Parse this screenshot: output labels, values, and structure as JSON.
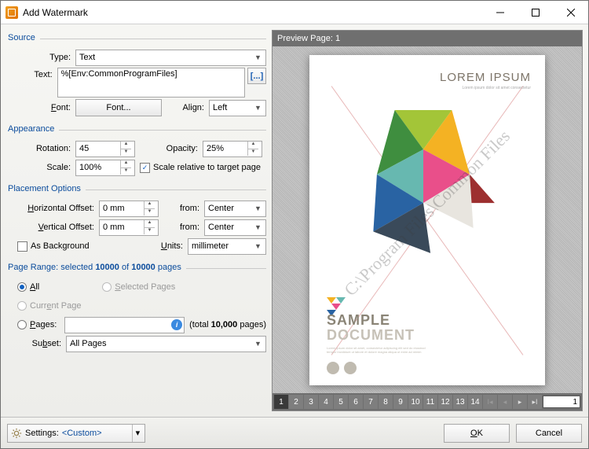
{
  "window": {
    "title": "Add Watermark"
  },
  "source": {
    "section": "Source",
    "type_label": "Type:",
    "type_value": "Text",
    "text_label": "Text:",
    "text_value": "%[Env:CommonProgramFiles]",
    "macro_button": "[...]",
    "font_label": "Font:",
    "font_button": "Font...",
    "align_label": "Align:",
    "align_value": "Left"
  },
  "appearance": {
    "section": "Appearance",
    "rotation_label": "Rotation:",
    "rotation_value": "45",
    "opacity_label": "Opacity:",
    "opacity_value": "25%",
    "scale_label": "Scale:",
    "scale_value": "100%",
    "scale_relative_label": "Scale relative to target page",
    "scale_relative_checked": true
  },
  "placement": {
    "section": "Placement Options",
    "hoffset_label": "Horizontal Offset:",
    "hoffset_value": "0 mm",
    "hoffset_from_label": "from:",
    "hoffset_from_value": "Center",
    "voffset_label": "Vertical Offset:",
    "voffset_value": "0 mm",
    "voffset_from_label": "from:",
    "voffset_from_value": "Center",
    "as_background_label": "As Background",
    "as_background_checked": false,
    "units_label": "Units:",
    "units_value": "millimeter"
  },
  "pagerange": {
    "section": "Page Range: selected 10000 of 10000 pages",
    "all_label": "All",
    "selected_label": "Selected Pages",
    "current_label": "Current Page",
    "pages_label": "Pages:",
    "pages_value": "",
    "total_label": "(total 10,000 pages)",
    "subset_label": "Subset:",
    "subset_value": "All Pages",
    "selected_radio": "all"
  },
  "preview": {
    "header": "Preview Page: 1",
    "doc_title": "LOREM IPSUM",
    "sample1": "SAMPLE",
    "sample2": "DOCUMENT",
    "watermark_text": "C:\\Program Files\\Common Files",
    "pages": [
      "1",
      "2",
      "3",
      "4",
      "5",
      "6",
      "7",
      "8",
      "9",
      "10",
      "11",
      "12",
      "13",
      "14"
    ],
    "current_page": "1",
    "page_input": "1"
  },
  "footer": {
    "settings_label": "Settings:",
    "settings_value": "<Custom>",
    "ok": "OK",
    "cancel": "Cancel"
  }
}
